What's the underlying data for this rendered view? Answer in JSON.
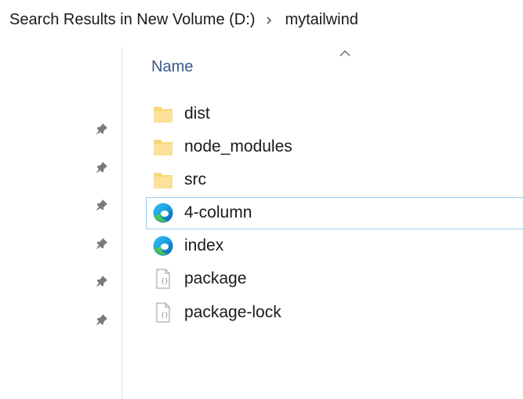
{
  "breadcrumb": {
    "items": [
      "Search Results in New Volume (D:)",
      "mytailwind"
    ],
    "separator_icon": "chevron-right-icon"
  },
  "columns": {
    "name_header": "Name",
    "sort_icon": "sort-ascending-icon"
  },
  "quick_access_pins": 6,
  "files": [
    {
      "name": "dist",
      "icon": "folder-icon",
      "selected": false
    },
    {
      "name": "node_modules",
      "icon": "folder-icon",
      "selected": false
    },
    {
      "name": "src",
      "icon": "folder-icon",
      "selected": false
    },
    {
      "name": "4-column",
      "icon": "edge-browser-icon",
      "selected": true
    },
    {
      "name": "index",
      "icon": "edge-browser-icon",
      "selected": false
    },
    {
      "name": "package",
      "icon": "json-file-icon",
      "selected": false
    },
    {
      "name": "package-lock",
      "icon": "json-file-icon",
      "selected": false
    }
  ],
  "colors": {
    "folder": "#F8D775",
    "selection_border": "#99C9EF",
    "header_text": "#3A5A8C"
  }
}
